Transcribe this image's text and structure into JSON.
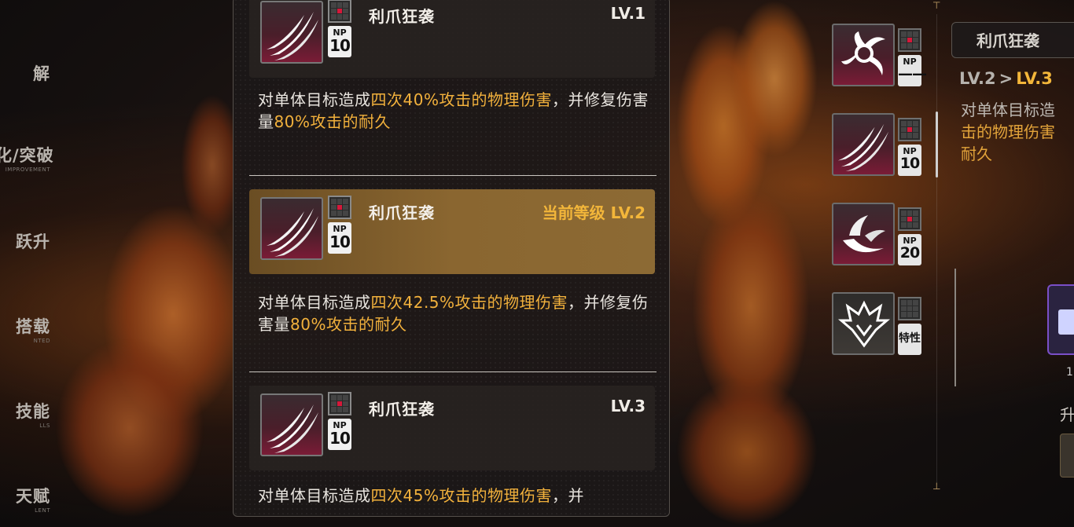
{
  "left_menu": [
    {
      "cn": "解",
      "en": ""
    },
    {
      "cn": "化/突破",
      "en": "IMPROVEMENT"
    },
    {
      "cn": "跃升",
      "en": ""
    },
    {
      "cn": "搭载",
      "en": "NTED"
    },
    {
      "cn": "技能",
      "en": "LLS"
    },
    {
      "cn": "天赋",
      "en": "LENT"
    }
  ],
  "skill_levels": [
    {
      "name": "利爪狂袭",
      "level_label": "LV.1",
      "np_label": "NP",
      "np_value": "10",
      "current": false,
      "desc_plain_1": "对单体目标造成",
      "desc_hl_1": "四次40%攻击的物理伤害",
      "desc_plain_2": "，并修复伤害量",
      "desc_hl_2": "80%攻击的耐久"
    },
    {
      "name": "利爪狂袭",
      "level_label": "当前等级 LV.2",
      "np_label": "NP",
      "np_value": "10",
      "current": true,
      "desc_plain_1": "对单体目标造成",
      "desc_hl_1": "四次42.5%攻击的物理伤害",
      "desc_plain_2": "，并修复伤害量",
      "desc_hl_2": "80%攻击的耐久"
    },
    {
      "name": "利爪狂袭",
      "level_label": "LV.3",
      "np_label": "NP",
      "np_value": "10",
      "current": false,
      "desc_plain_1": "对单体目标造成",
      "desc_hl_1": "四次45%攻击的物理伤害",
      "desc_plain_2": "，并",
      "desc_hl_2": ""
    }
  ],
  "side_skills": [
    {
      "np_label": "NP",
      "np_value": "——",
      "icon": "swirl-claw-icon"
    },
    {
      "np_label": "NP",
      "np_value": "10",
      "icon": "claw-slash-icon"
    },
    {
      "np_label": "NP",
      "np_value": "20",
      "icon": "crescent-strike-icon"
    },
    {
      "np_label": "特性",
      "np_value": "",
      "icon": "beast-crest-icon"
    }
  ],
  "detail": {
    "title": "利爪狂袭",
    "lv_current": "LV.2",
    "lv_arrow": ">",
    "lv_next": "LV.3",
    "desc_plain": "对单体目标造",
    "desc_hl": "击的物理伤害",
    "desc_tail": "耐久",
    "side_text_1": "1",
    "side_text_2": "升"
  },
  "colors": {
    "highlight": "#f2b13c",
    "current_row": "#8a6630",
    "np_red": "#d6183a"
  }
}
